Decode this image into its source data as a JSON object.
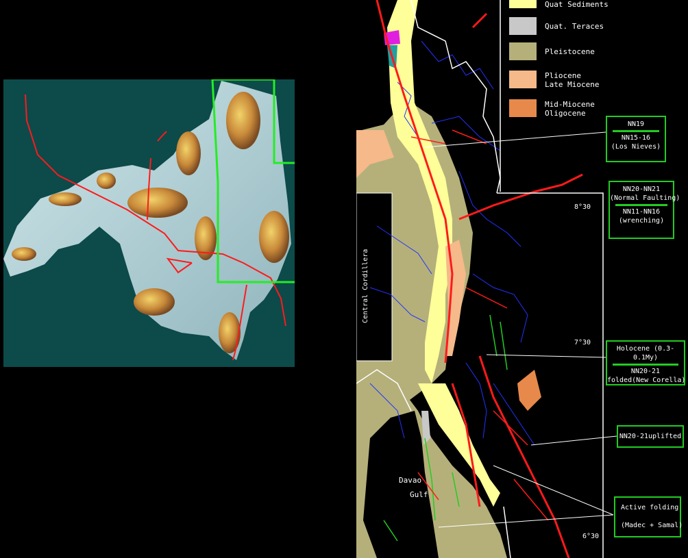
{
  "legend": [
    {
      "label": "Quat Sediments",
      "color": "#ffff99"
    },
    {
      "label": "Quat. Teraces",
      "color": "#c8c8c8"
    },
    {
      "label": "Pleistocene",
      "color": "#b5b07a"
    },
    {
      "label": "Pliocene\nLate Miocene",
      "color": "#f5b98a"
    },
    {
      "label": "Mid-Miocene\nOligocene",
      "color": "#e7894a"
    }
  ],
  "boxes": {
    "nn19": {
      "top": "NN19",
      "bottom": "NN15-16\n(Los Nieves)"
    },
    "nn20": {
      "top": "NN20-NN21\n(Normal Faulting)",
      "bottom": "NN11-NN16\n(wrenching)"
    },
    "holocene": {
      "top": "Holocene (0.3-0.1My)",
      "bottom": "NN20-21\nfolded(New Corella)"
    },
    "uplifted": {
      "text": "NN20-21uplifted"
    },
    "active": {
      "text": "Active folding\n\n(Madec + Samal)"
    }
  },
  "latitudes": [
    "8°30",
    "7°30",
    "6°30"
  ],
  "labels": {
    "cordillera": "Central Cordillera",
    "davao1": "Davao",
    "davao2": "Gulf"
  },
  "colors": {
    "fault": "#ff1a1a",
    "frame": "#22cc22",
    "rivers": "#2233ff",
    "coast": "#ffffff",
    "sea": "#0d4a4a"
  }
}
